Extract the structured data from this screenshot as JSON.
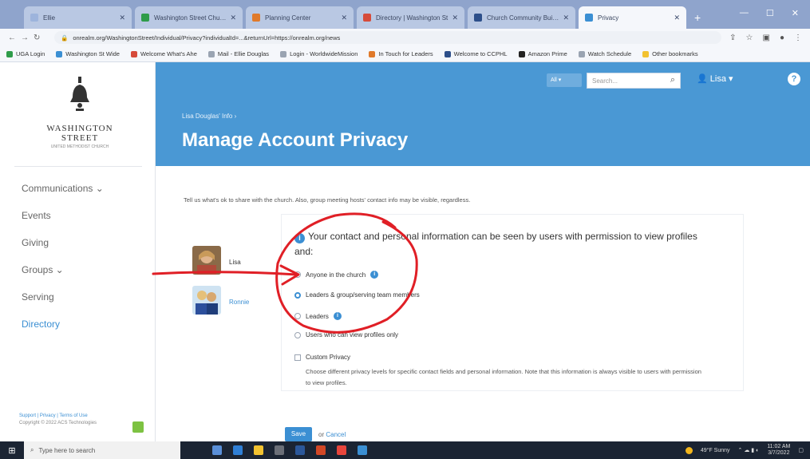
{
  "browser": {
    "tabs": [
      {
        "label": "Ellie",
        "active": false,
        "color": "#9db4dc"
      },
      {
        "label": "Washington Street Church",
        "active": false,
        "color": "#2f9c4a"
      },
      {
        "label": "Planning Center",
        "active": false,
        "color": "#e07a2b"
      },
      {
        "label": "Directory | Washington St",
        "active": false,
        "color": "#d64b3a"
      },
      {
        "label": "Church Community Builder",
        "active": false,
        "color": "#2d4f8a"
      },
      {
        "label": "Privacy",
        "active": true,
        "color": "#3b8fd3"
      }
    ],
    "new_tab": "+",
    "url": "onrealm.org/WashingtonStreet/Individual/Privacy?individualId=...&returnUrl=https://onrealm.org/news",
    "bookmarks": [
      "UGA Login",
      "Washington St Wide",
      "Welcome What's Ahe",
      "Mail - Ellie Douglas",
      "Login - WorldwideMission",
      "In Touch for Leaders",
      "Welcome to CCPHL",
      "Amazon Prime",
      "Watch Schedule",
      "Other bookmarks"
    ]
  },
  "sidebar": {
    "logo": {
      "line1": "WASHINGTON",
      "line2": "STREET",
      "line3": "UNITED METHODIST CHURCH"
    },
    "menu": [
      {
        "label": "Communications ⌄",
        "active": false
      },
      {
        "label": "Events",
        "active": false
      },
      {
        "label": "Giving",
        "active": false
      },
      {
        "label": "Groups ⌄",
        "active": false
      },
      {
        "label": "Serving",
        "active": false
      },
      {
        "label": "Directory",
        "active": true
      }
    ],
    "footer_links": "Support | Privacy | Terms of Use",
    "footer_copy": "Copyright © 2022 ACS Technologies"
  },
  "header": {
    "breadcrumb": "Lisa Douglas' Info ›",
    "title": "Manage Account Privacy",
    "select_label": "All ▾",
    "search_placeholder": "Search...",
    "user_label": "Lisa ▾",
    "help": "?"
  },
  "main": {
    "intro": "Tell us what's ok to share with the church. Also, group meeting hosts' contact info may be visible, regardless.",
    "people": [
      {
        "name": "Lisa",
        "link": false
      },
      {
        "name": "Ronnie",
        "link": true
      }
    ],
    "heading": "Your contact and personal information can be seen by users with permission to view profiles and:",
    "options": [
      {
        "label": "Anyone in the church",
        "selected": false,
        "info": true
      },
      {
        "label": "Leaders & group/serving team members",
        "selected": true,
        "info": false
      },
      {
        "label": "Leaders",
        "selected": false,
        "info": true
      },
      {
        "label": "Users who can view profiles only",
        "selected": false,
        "info": false
      }
    ],
    "custom": {
      "label": "Custom Privacy",
      "description": "Choose different privacy levels for specific contact fields and personal information. Note that this information is always visible to users with permission to view profiles."
    },
    "save_label": "Save",
    "or_label": "or",
    "cancel_label": "Cancel"
  },
  "taskbar": {
    "search_text": "Type here to search",
    "weather": "49°F Sunny",
    "time": "11:02 AM",
    "date": "3/7/2022"
  },
  "colors": {
    "accent": "#4a98d4",
    "annotation": "#e01f26"
  }
}
